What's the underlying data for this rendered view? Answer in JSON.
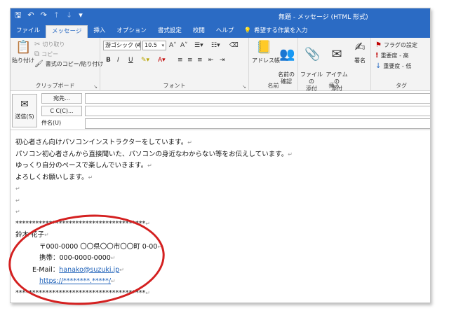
{
  "window": {
    "title": "無題  -  メッセージ (HTML 形式)"
  },
  "qat": {
    "save": "🖫",
    "undo": "↶",
    "redo": "↷",
    "up": "↑",
    "down": "↓",
    "more": "▾"
  },
  "tabs": [
    {
      "label": "ファイル"
    },
    {
      "label": "メッセージ"
    },
    {
      "label": "挿入"
    },
    {
      "label": "オプション"
    },
    {
      "label": "書式設定"
    },
    {
      "label": "校閲"
    },
    {
      "label": "ヘルプ"
    }
  ],
  "tellme": {
    "icon": "💡",
    "label": "希望する作業を入力"
  },
  "ribbon": {
    "clipboard": {
      "paste": "貼り付け",
      "cut": "切り取り",
      "copy": "コピー",
      "format_painter": "書式のコピー/貼り付け",
      "group": "クリップボード"
    },
    "font": {
      "font_name": "游ゴシック (本",
      "font_size": "10.5",
      "grow": "A˄",
      "shrink": "A˅",
      "bold": "B",
      "italic": "I",
      "underline": "U",
      "group": "フォント"
    },
    "names": {
      "address_book": "アドレス帳",
      "check_names": "名前の\n確認",
      "group": "名前"
    },
    "insert": {
      "attach_file": "ファイルの\n添付",
      "attach_item": "アイテムの\n添付",
      "signature": "署名",
      "group": "挿入"
    },
    "tags": {
      "follow_up": "フラグの設定",
      "high": "重要度 - 高",
      "low": "重要度 - 低",
      "group": "タグ"
    }
  },
  "header": {
    "send": "送信(S)",
    "to": "宛先...",
    "cc": "C C(C)...",
    "subject": "件名(U)"
  },
  "body": {
    "lines": [
      "初心者さん向けパソコンインストラクターをしています。",
      "パソコン初心者さんから直接聞いた、パソコンの身近なわからない等をお伝えしています。",
      "ゆっくり自分のペースで楽しんでいきます。",
      "よろしくお願いします。"
    ],
    "para_mark": "↵",
    "separator": "***************************************",
    "sig_name": "鈴木  花子",
    "sig_address": "〒000-0000   〇〇県〇〇市〇〇町 0-00",
    "sig_mobile": "携帯：000-0000-0000",
    "sig_email_label": "E-Mail：",
    "sig_email": "hanako@suzuki.jp",
    "sig_url": "https://********.*****/"
  },
  "colors": {
    "accent": "#2b6bc4",
    "annotation": "#d42020",
    "link": "#1b5fb8"
  }
}
